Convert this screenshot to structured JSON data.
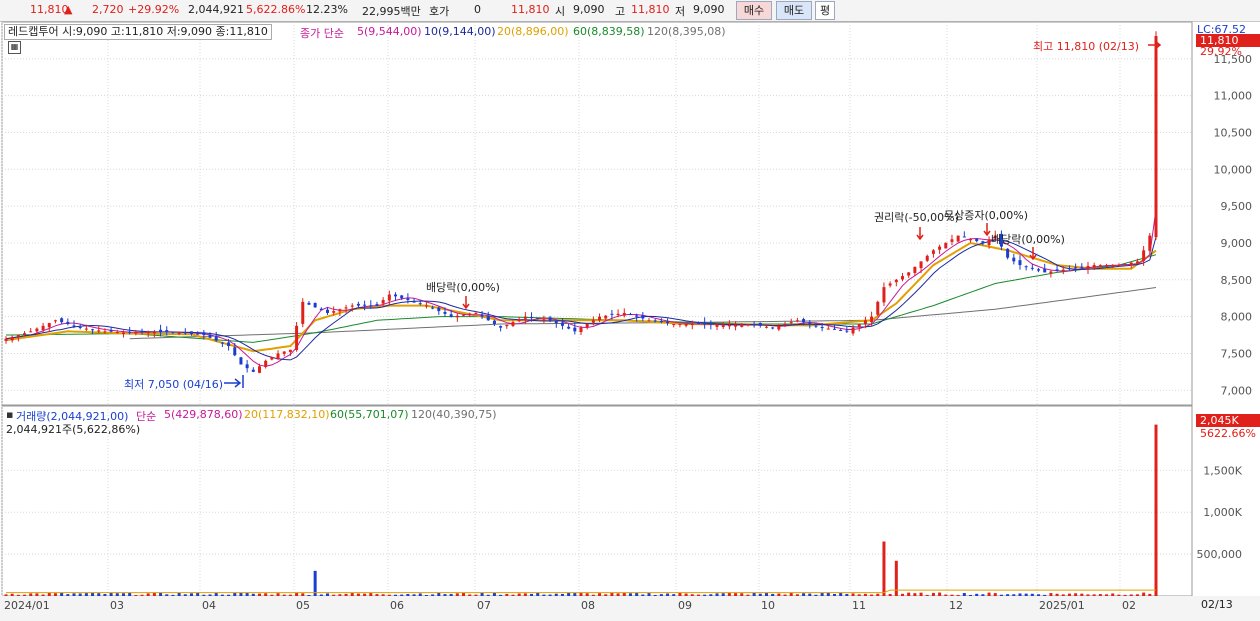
{
  "topbar": {
    "price": "11,810",
    "change": "2,720",
    "change_pct": "+29.92%",
    "volume": "2,044,921",
    "volume_pct": "5,622.86%",
    "turnover_pct": "12.23%",
    "amount": "22,995백만",
    "quote_label": "호가",
    "quote_value": "0",
    "quote_price": "11,810",
    "open_label": "시",
    "open": "9,090",
    "high_label": "고",
    "high": "11,810",
    "low_label": "저",
    "low": "9,090",
    "buy_label": "매수",
    "sell_label": "매도",
    "flat_label": "평"
  },
  "price_legend": {
    "title": "레드캡투어 시:9,090 고:11,810 저:9,090 종:11,810",
    "ma_prefix": "종가 단순",
    "ma5": "5(9,544,00)",
    "ma10": "10(9,144,00)",
    "ma20": "20(8,896,00)",
    "ma60": "60(8,839,58)",
    "ma120": "120(8,395,08)"
  },
  "volume_legend": {
    "title": "거래량(2,044,921,00)",
    "ma_prefix": "단순",
    "ma5": "5(429,878,60)",
    "ma20": "20(117,832,10)",
    "ma60": "60(55,701,07)",
    "ma120": "120(40,390,75)",
    "sub": "2,044,921주(5,622,86%)"
  },
  "annotations": {
    "high": "최고 11,810 (02/13)",
    "low": "최저 7,050 (04/16)",
    "div1": "배당락(0,00%)",
    "rights": "권리락(-50,00%)",
    "bonus": "무상증자(0,00%)",
    "div2": "배당락(0,00%)"
  },
  "axis": {
    "lc": "LC:67.52",
    "last_price": "11,810",
    "last_pct": "29.92%",
    "vol_last": "2,045K",
    "vol_pct": "5622.66%",
    "end_date": "02/13"
  },
  "colors": {
    "up": "#e0201a",
    "down": "#1a3fd0",
    "ma5": "#c8189a",
    "ma10": "#1a2aa0",
    "ma20": "#e0a000",
    "ma60": "#1a8a2a",
    "ma120": "#707070"
  },
  "chart_data": [
    {
      "type": "candlestick",
      "title": "레드캡투어",
      "x_range": [
        "2024-01",
        "2025-02-13"
      ],
      "ylim": [
        6800,
        12000
      ],
      "y_ticks": [
        "7,000",
        "7,500",
        "8,000",
        "8,500",
        "9,000",
        "9,500",
        "10,000",
        "10,500",
        "11,000",
        "11,500"
      ],
      "y_tick_values": [
        7000,
        7500,
        8000,
        8500,
        9000,
        9500,
        10000,
        10500,
        11000,
        11500
      ],
      "x_ticks": [
        "2024/01",
        "03",
        "04",
        "05",
        "06",
        "07",
        "08",
        "09",
        "10",
        "11",
        "12",
        "2025/01",
        "02"
      ],
      "close_path": [
        [
          0,
          7700
        ],
        [
          4,
          7800
        ],
        [
          8,
          7950
        ],
        [
          12,
          7850
        ],
        [
          16,
          7800
        ],
        [
          20,
          7780
        ],
        [
          24,
          7800
        ],
        [
          28,
          7780
        ],
        [
          32,
          7750
        ],
        [
          36,
          7600
        ],
        [
          38,
          7350
        ],
        [
          40,
          7250
        ],
        [
          42,
          7400
        ],
        [
          44,
          7500
        ],
        [
          46,
          7550
        ],
        [
          48,
          8200
        ],
        [
          52,
          8050
        ],
        [
          56,
          8150
        ],
        [
          60,
          8150
        ],
        [
          62,
          8300
        ],
        [
          64,
          8250
        ],
        [
          68,
          8150
        ],
        [
          72,
          8000
        ],
        [
          76,
          8050
        ],
        [
          80,
          7850
        ],
        [
          84,
          8000
        ],
        [
          88,
          7950
        ],
        [
          92,
          7800
        ],
        [
          96,
          8000
        ],
        [
          100,
          8050
        ],
        [
          104,
          7950
        ],
        [
          108,
          7900
        ],
        [
          112,
          7900
        ],
        [
          116,
          7880
        ],
        [
          120,
          7900
        ],
        [
          124,
          7850
        ],
        [
          128,
          7950
        ],
        [
          132,
          7850
        ],
        [
          136,
          7800
        ],
        [
          140,
          8000
        ],
        [
          142,
          8400
        ],
        [
          146,
          8600
        ],
        [
          150,
          8900
        ],
        [
          154,
          9100
        ],
        [
          158,
          9000
        ],
        [
          160,
          9100
        ],
        [
          162,
          8800
        ],
        [
          164,
          8700
        ],
        [
          168,
          8600
        ],
        [
          172,
          8650
        ],
        [
          176,
          8700
        ],
        [
          180,
          8700
        ],
        [
          183,
          8750
        ],
        [
          184,
          8900
        ],
        [
          185,
          9100
        ],
        [
          186,
          11810
        ]
      ],
      "ma20_path": [
        [
          0,
          7680
        ],
        [
          10,
          7800
        ],
        [
          20,
          7770
        ],
        [
          30,
          7760
        ],
        [
          40,
          7530
        ],
        [
          46,
          7600
        ],
        [
          50,
          7950
        ],
        [
          56,
          8100
        ],
        [
          62,
          8150
        ],
        [
          68,
          8150
        ],
        [
          74,
          8050
        ],
        [
          80,
          7950
        ],
        [
          90,
          7950
        ],
        [
          100,
          7950
        ],
        [
          110,
          7900
        ],
        [
          120,
          7890
        ],
        [
          130,
          7880
        ],
        [
          140,
          7950
        ],
        [
          144,
          8180
        ],
        [
          150,
          8700
        ],
        [
          156,
          9000
        ],
        [
          162,
          8900
        ],
        [
          170,
          8700
        ],
        [
          176,
          8650
        ],
        [
          182,
          8650
        ],
        [
          186,
          8896
        ]
      ],
      "ma60_path": [
        [
          0,
          7750
        ],
        [
          20,
          7770
        ],
        [
          40,
          7650
        ],
        [
          50,
          7780
        ],
        [
          60,
          7950
        ],
        [
          70,
          8000
        ],
        [
          80,
          8000
        ],
        [
          100,
          7950
        ],
        [
          120,
          7900
        ],
        [
          140,
          7900
        ],
        [
          150,
          8150
        ],
        [
          160,
          8450
        ],
        [
          170,
          8600
        ],
        [
          180,
          8700
        ],
        [
          186,
          8840
        ]
      ],
      "ma120_path": [
        [
          20,
          7700
        ],
        [
          50,
          7780
        ],
        [
          80,
          7900
        ],
        [
          110,
          7920
        ],
        [
          140,
          7950
        ],
        [
          160,
          8100
        ],
        [
          186,
          8395
        ]
      ],
      "events": [
        {
          "label": "최고 11,810 (02/13)",
          "value": 11810
        },
        {
          "label": "최저 7,050 (04/16)",
          "value": 7050
        },
        {
          "label": "배당락(0,00%)"
        },
        {
          "label": "권리락(-50,00%)"
        },
        {
          "label": "무상증자(0,00%)"
        },
        {
          "label": "배당락(0,00%)"
        }
      ]
    },
    {
      "type": "bar",
      "title": "거래량",
      "ylim": [
        0,
        2100000
      ],
      "y_ticks": [
        "500,000",
        "1,000K",
        "1,500K"
      ],
      "y_tick_values": [
        500000,
        1000000,
        1500000
      ],
      "last_value": 2044921,
      "spikes": [
        {
          "idx": 50,
          "value": 300000
        },
        {
          "idx": 142,
          "value": 650000
        },
        {
          "idx": 144,
          "value": 420000
        },
        {
          "idx": 186,
          "value": 2044921
        }
      ],
      "baseline_value": 30000
    }
  ]
}
